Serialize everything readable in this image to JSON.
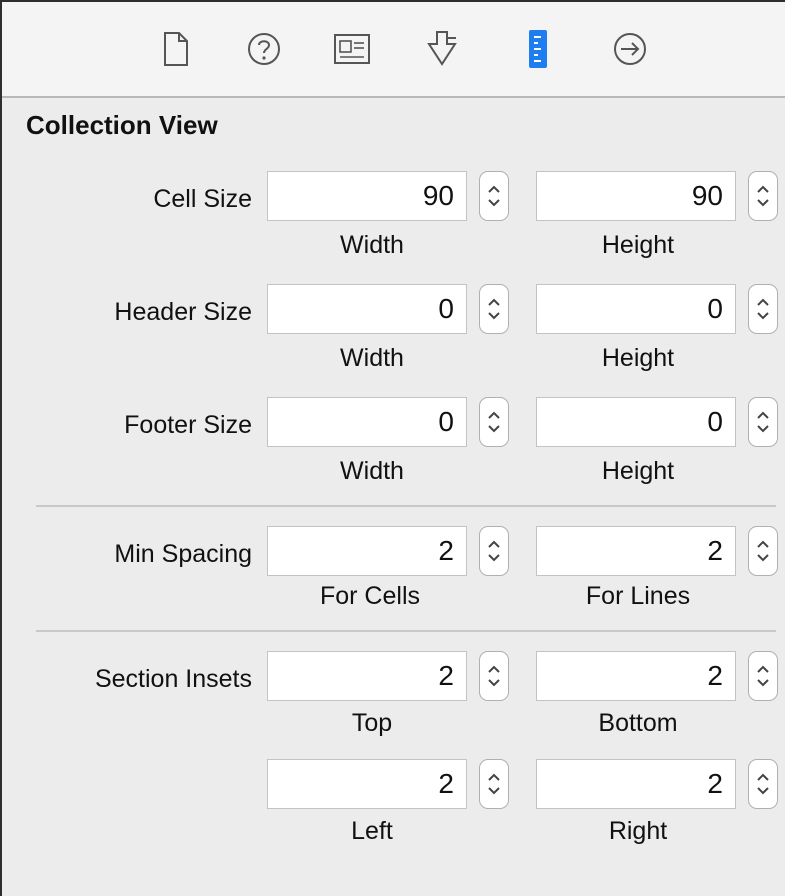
{
  "toolbar": {
    "icons": [
      "file-inspector-icon",
      "quick-help-icon",
      "identity-inspector-icon",
      "attributes-inspector-icon",
      "size-inspector-icon",
      "connections-inspector-icon"
    ],
    "active_color": "#1e7ef0"
  },
  "section": {
    "title": "Collection View"
  },
  "rows": {
    "cell_size": {
      "label": "Cell Size",
      "first": {
        "value": "90",
        "caption": "Width"
      },
      "second": {
        "value": "90",
        "caption": "Height"
      }
    },
    "header_size": {
      "label": "Header Size",
      "first": {
        "value": "0",
        "caption": "Width"
      },
      "second": {
        "value": "0",
        "caption": "Height"
      }
    },
    "footer_size": {
      "label": "Footer Size",
      "first": {
        "value": "0",
        "caption": "Width"
      },
      "second": {
        "value": "0",
        "caption": "Height"
      }
    },
    "min_spacing": {
      "label": "Min Spacing",
      "first": {
        "value": "2",
        "caption": "For Cells"
      },
      "second": {
        "value": "2",
        "caption": "For Lines"
      }
    },
    "section_insets": {
      "label": "Section Insets",
      "first": {
        "value": "2",
        "caption": "Top"
      },
      "second": {
        "value": "2",
        "caption": "Bottom"
      }
    },
    "section_insets_2": {
      "first": {
        "value": "2",
        "caption": "Left"
      },
      "second": {
        "value": "2",
        "caption": "Right"
      }
    }
  }
}
